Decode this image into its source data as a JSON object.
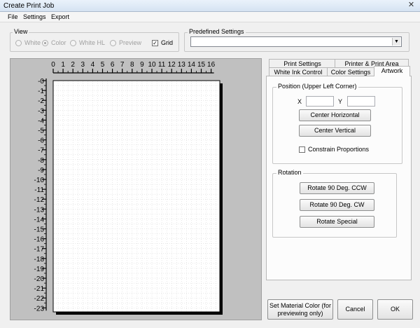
{
  "window": {
    "title": "Create Print Job",
    "close_glyph": "✕"
  },
  "menu": [
    "File",
    "Settings",
    "Export"
  ],
  "view": {
    "label": "View",
    "options": [
      {
        "label": "White",
        "selected": false,
        "enabled": false
      },
      {
        "label": "Color",
        "selected": true,
        "enabled": false
      },
      {
        "label": "White HL",
        "selected": false,
        "enabled": false
      },
      {
        "label": "Preview",
        "selected": false,
        "enabled": false
      }
    ],
    "grid": {
      "label": "Grid",
      "checked": true,
      "mark": "✓"
    }
  },
  "predefined": {
    "label": "Predefined Settings",
    "value": "",
    "arrow": "▼"
  },
  "ruler": {
    "horizontal": [
      "0",
      "1",
      "2",
      "3",
      "4",
      "5",
      "6",
      "7",
      "8",
      "9",
      "10",
      "11",
      "12",
      "13",
      "14",
      "15",
      "16"
    ],
    "vertical": [
      "0",
      "1",
      "2",
      "3",
      "4",
      "5",
      "6",
      "7",
      "8",
      "9",
      "10",
      "11",
      "12",
      "13",
      "14",
      "15",
      "16",
      "17",
      "18",
      "19",
      "20",
      "21",
      "22",
      "23"
    ],
    "vertical_prefix": "-"
  },
  "tabs": {
    "row_back": [
      "Print Settings",
      "Printer & Print Area"
    ],
    "row_front": [
      "White Ink Control",
      "Color Settings",
      "Artwork"
    ],
    "active": "Artwork"
  },
  "position": {
    "label": "Position (Upper Left Corner)",
    "x_label": "X",
    "y_label": "Y",
    "x_value": "",
    "y_value": "",
    "center_h": "Center Horizontal",
    "center_v": "Center Vertical",
    "constrain": {
      "label": "Constrain Proportions",
      "checked": false
    }
  },
  "rotation": {
    "label": "Rotation",
    "ccw": "Rotate 90 Deg. CCW",
    "cw": "Rotate 90 Deg. CW",
    "special": "Rotate Special"
  },
  "buttons": {
    "material": "Set Material Color (for previewing only)",
    "cancel": "Cancel",
    "ok": "OK"
  },
  "colors": {
    "canvas_bg": "#c0c0c0",
    "page": "#ffffff",
    "grid": "#d0d0d0"
  }
}
